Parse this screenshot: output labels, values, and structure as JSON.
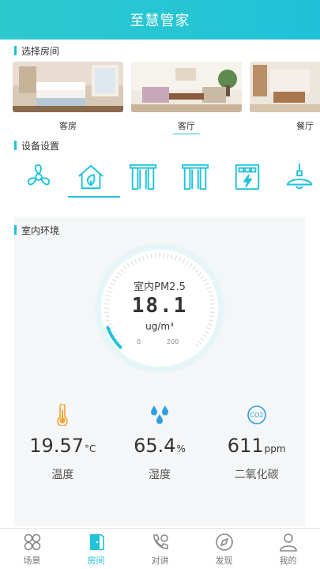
{
  "app": {
    "title": "至慧管家"
  },
  "rooms_section": {
    "title": "选择房间",
    "rooms": [
      {
        "label": "客房",
        "active": false
      },
      {
        "label": "客厅",
        "active": true
      },
      {
        "label": "餐厅",
        "active": false
      }
    ]
  },
  "devices_section": {
    "title": "设备设置",
    "devices": [
      {
        "icon": "fan-icon",
        "active": false
      },
      {
        "icon": "house-leaf-icon",
        "active": true
      },
      {
        "icon": "curtain-icon",
        "active": false
      },
      {
        "icon": "curtain-icon",
        "active": false
      },
      {
        "icon": "heater-icon",
        "active": false
      },
      {
        "icon": "ceiling-lamp-icon",
        "active": false
      }
    ]
  },
  "environment": {
    "title": "室内环境",
    "pm25": {
      "label": "室内PM2.5",
      "value": "18.1",
      "unit": "ug/m³",
      "min": "0",
      "max": "200"
    },
    "stats": [
      {
        "icon": "thermometer-icon",
        "value": "19.57",
        "unit": "°C",
        "name": "温度"
      },
      {
        "icon": "water-drops-icon",
        "value": "65.4",
        "unit": "%",
        "name": "湿度"
      },
      {
        "icon": "co2-icon",
        "value": "611",
        "unit": "ppm",
        "name": "二氧化碳"
      }
    ]
  },
  "tabbar": {
    "tabs": [
      {
        "label": "场景",
        "icon": "scene-icon",
        "active": false
      },
      {
        "label": "房间",
        "icon": "room-door-icon",
        "active": true
      },
      {
        "label": "对讲",
        "icon": "intercom-phone-icon",
        "active": false
      },
      {
        "label": "发现",
        "icon": "compass-icon",
        "active": false
      },
      {
        "label": "我的",
        "icon": "person-icon",
        "active": false
      }
    ]
  },
  "colors": {
    "accent": "#1fc2d8",
    "header": "#2ec9cf",
    "panel": "#f4f6f7"
  }
}
